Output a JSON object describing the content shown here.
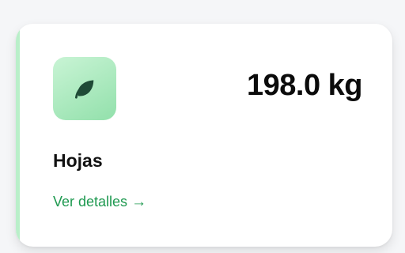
{
  "card": {
    "value": "198.0 kg",
    "label": "Hojas",
    "link_label": "Ver detalles",
    "link_arrow": "→",
    "icon": "leaf-icon"
  },
  "colors": {
    "accent": "#b9efc9",
    "icon_tile": "#a8e8bc",
    "icon_glyph": "#1f4a36",
    "link": "#1e9950",
    "text": "#111111"
  }
}
